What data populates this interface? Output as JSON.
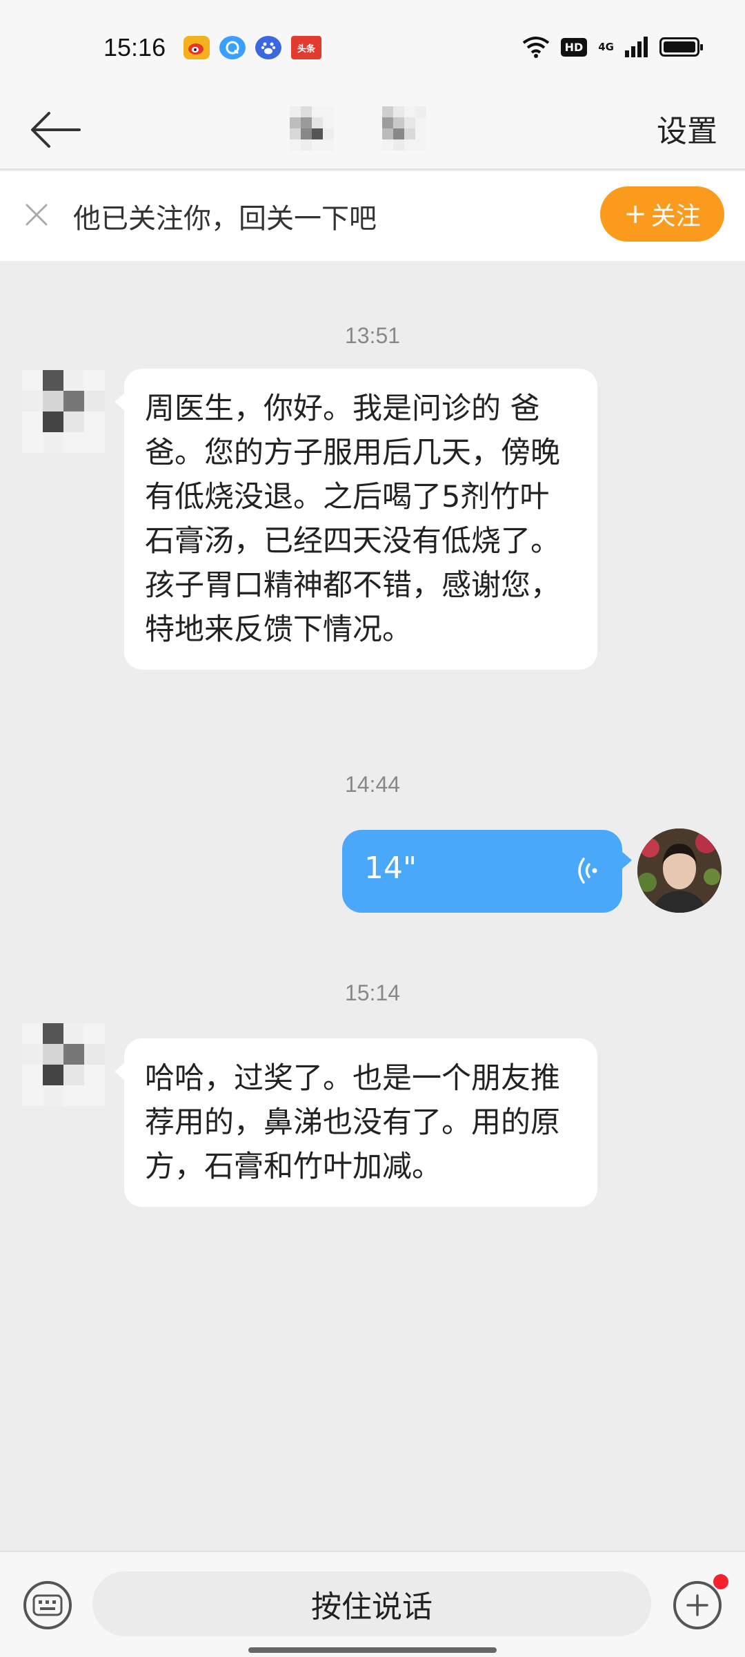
{
  "status_bar": {
    "time": "15:16",
    "notification_icons": [
      "weibo-icon",
      "qq-browser-icon",
      "baidu-icon",
      "toutiao-icon"
    ],
    "toutiao_label": "头条",
    "hd_label": "HD",
    "network_label": "4G"
  },
  "header": {
    "settings_label": "设置"
  },
  "follow_banner": {
    "text": "他已关注你，回关一下吧",
    "button_plus": "+",
    "button_label": "关注"
  },
  "chat": {
    "messages": [
      {
        "timestamp": "13:51",
        "sender": "other",
        "text": "周医生，你好。我是问诊的 爸爸。您的方子服用后几天，傍晚有低烧没退。之后喝了5剂竹叶石膏汤，已经四天没有低烧了。孩子胃口精神都不错，感谢您，特地来反馈下情况。"
      },
      {
        "timestamp": "14:44",
        "sender": "me",
        "type": "voice",
        "duration": "14\""
      },
      {
        "timestamp": "15:14",
        "sender": "other",
        "text": "哈哈，过奖了。也是一个朋友推荐用的，鼻涕也没有了。用的原方，石膏和竹叶加减。"
      }
    ]
  },
  "bottom_bar": {
    "hold_to_talk": "按住说话"
  },
  "colors": {
    "follow_button": "#fa9b1d",
    "voice_bubble": "#4aa8fb",
    "chat_background": "#ededed"
  }
}
